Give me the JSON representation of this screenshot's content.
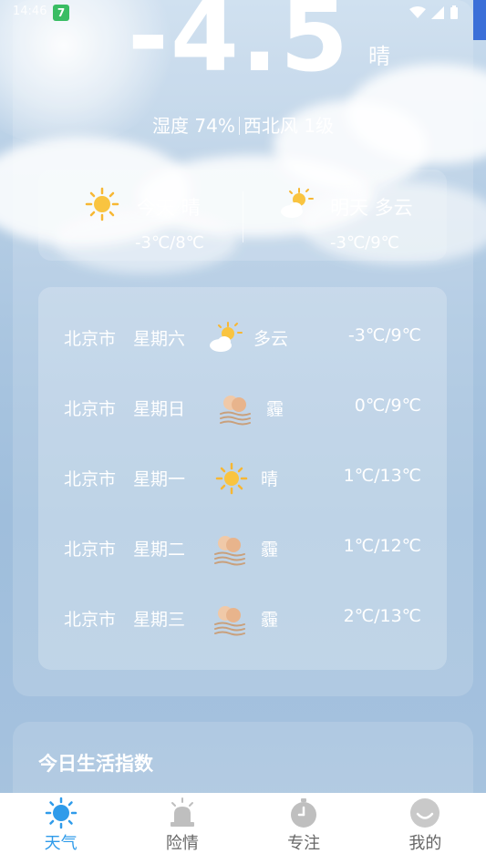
{
  "status_bar": {
    "time": "14:46",
    "app_badge": "7"
  },
  "current": {
    "temperature": "-4.5",
    "condition": "晴",
    "humidity_wind": "湿度  74%",
    "wind": "西北风  1级"
  },
  "today": {
    "label": "今天 晴",
    "range": "-3℃/8℃"
  },
  "tomorrow": {
    "label": "明天 多云",
    "range": "-3℃/9℃"
  },
  "forecast": [
    {
      "city": "北京市",
      "weekday": "星期六",
      "icon": "partly-cloudy-icon",
      "condition": "多云",
      "range": "-3℃/9℃"
    },
    {
      "city": "北京市",
      "weekday": "星期日",
      "icon": "haze-icon",
      "condition": "霾",
      "range": "0℃/9℃"
    },
    {
      "city": "北京市",
      "weekday": "星期一",
      "icon": "sun-icon",
      "condition": "晴",
      "range": "1℃/13℃"
    },
    {
      "city": "北京市",
      "weekday": "星期二",
      "icon": "haze-icon",
      "condition": "霾",
      "range": "1℃/12℃"
    },
    {
      "city": "北京市",
      "weekday": "星期三",
      "icon": "haze-icon",
      "condition": "霾",
      "range": "2℃/13℃"
    }
  ],
  "life_index": {
    "title": "今日生活指数"
  },
  "tabs": [
    {
      "label": "天气",
      "icon": "sun-icon",
      "active": true
    },
    {
      "label": "险情",
      "icon": "alarm-icon",
      "active": false
    },
    {
      "label": "专注",
      "icon": "stopwatch-icon",
      "active": false
    },
    {
      "label": "我的",
      "icon": "smile-icon",
      "active": false
    }
  ],
  "colors": {
    "accent": "#2f9bea",
    "tab_inactive": "#666666",
    "sun": "#f7b733"
  }
}
